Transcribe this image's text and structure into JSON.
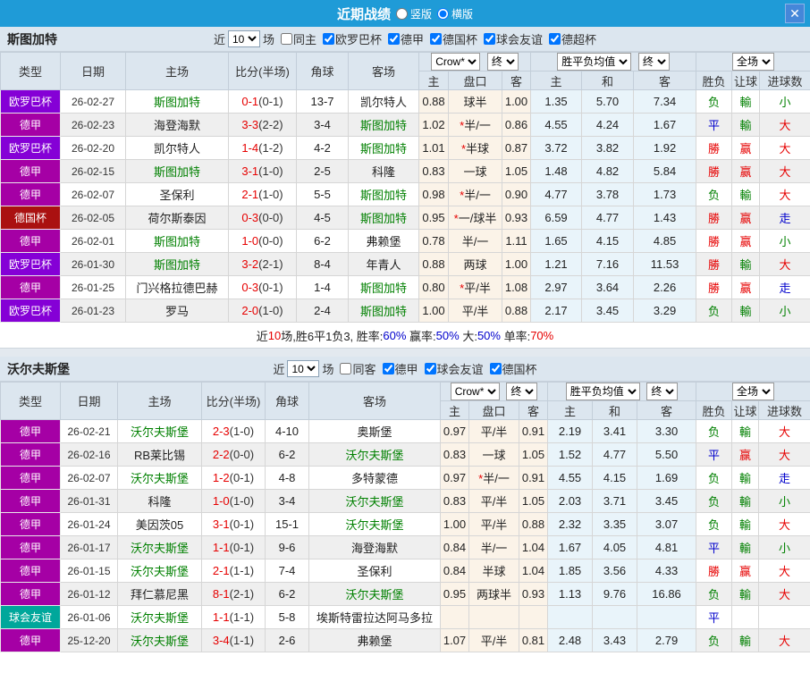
{
  "titlebar": {
    "title": "近期战绩",
    "vertical_label": "竖版",
    "horizontal_label": "横版",
    "selected": "横版",
    "close_icon": "✕",
    "bg_color": "#1f9bd7"
  },
  "labels": {
    "near": "近",
    "games": "场",
    "columns": [
      "类型",
      "日期",
      "主场",
      "比分(半场)",
      "角球",
      "客场"
    ],
    "subcolumns": [
      "主",
      "盘口",
      "客",
      "主",
      "和",
      "客",
      "胜负",
      "让球",
      "进球数"
    ]
  },
  "league_colors": {
    "europa": "#8500d6",
    "bundesliga": "#a500a5",
    "pokal": "#aa1111",
    "friendly": "#00a79b"
  },
  "status_colors": {
    "red": "#e60000",
    "blue": "#0000cc",
    "green": "#008000"
  },
  "tables": [
    {
      "team": "斯图加特",
      "near_count": "10",
      "same_label": "同主",
      "same_checked": false,
      "league_filters": [
        "欧罗巴杯",
        "德甲",
        "德国杯",
        "球会友谊",
        "德超杯"
      ],
      "dropdowns": {
        "company": "Crow*",
        "final1": "终",
        "avg": "胜平负均值",
        "final2": "终",
        "scope": "全场"
      },
      "rows": [
        {
          "league": "欧罗巴杯",
          "lg": "europa",
          "date": "26-02-27",
          "home": "斯图加特",
          "hf": 1,
          "score": "0-1",
          "half": "(0-1)",
          "corners": "13-7",
          "away": "凯尔特人",
          "af": 0,
          "h": "0.88",
          "star": "",
          "hcp": "球半",
          "a": "1.00",
          "ah": "1.35",
          "ad": "5.70",
          "aa": "7.34",
          "res": "负",
          "rc": "g",
          "hres": "輸",
          "gc": "g",
          "ou": "小",
          "oc": "g"
        },
        {
          "league": "德甲",
          "lg": "bundesliga",
          "date": "26-02-23",
          "home": "海登海默",
          "hf": 0,
          "score": "3-3",
          "half": "(2-2)",
          "corners": "3-4",
          "away": "斯图加特",
          "af": 1,
          "h": "1.02",
          "star": "*",
          "hcp": "半/一",
          "a": "0.86",
          "ah": "4.55",
          "ad": "4.24",
          "aa": "1.67",
          "res": "平",
          "rc": "b",
          "hres": "輸",
          "gc": "g",
          "ou": "大",
          "oc": "r"
        },
        {
          "league": "欧罗巴杯",
          "lg": "europa",
          "date": "26-02-20",
          "home": "凯尔特人",
          "hf": 0,
          "score": "1-4",
          "half": "(1-2)",
          "corners": "4-2",
          "away": "斯图加特",
          "af": 1,
          "h": "1.01",
          "star": "*",
          "hcp": "半球",
          "a": "0.87",
          "ah": "3.72",
          "ad": "3.82",
          "aa": "1.92",
          "res": "勝",
          "rc": "r",
          "hres": "赢",
          "gc": "r",
          "ou": "大",
          "oc": "r"
        },
        {
          "league": "德甲",
          "lg": "bundesliga",
          "date": "26-02-15",
          "home": "斯图加特",
          "hf": 1,
          "score": "3-1",
          "half": "(1-0)",
          "corners": "2-5",
          "away": "科隆",
          "af": 0,
          "h": "0.83",
          "star": "",
          "hcp": "一球",
          "a": "1.05",
          "ah": "1.48",
          "ad": "4.82",
          "aa": "5.84",
          "res": "勝",
          "rc": "r",
          "hres": "赢",
          "gc": "r",
          "ou": "大",
          "oc": "r"
        },
        {
          "league": "德甲",
          "lg": "bundesliga",
          "date": "26-02-07",
          "home": "圣保利",
          "hf": 0,
          "score": "2-1",
          "half": "(1-0)",
          "corners": "5-5",
          "away": "斯图加特",
          "af": 1,
          "h": "0.98",
          "star": "*",
          "hcp": "半/一",
          "a": "0.90",
          "ah": "4.77",
          "ad": "3.78",
          "aa": "1.73",
          "res": "负",
          "rc": "g",
          "hres": "輸",
          "gc": "g",
          "ou": "大",
          "oc": "r"
        },
        {
          "league": "德国杯",
          "lg": "pokal",
          "date": "26-02-05",
          "home": "荷尔斯泰因",
          "hf": 0,
          "score": "0-3",
          "half": "(0-0)",
          "corners": "4-5",
          "away": "斯图加特",
          "af": 1,
          "h": "0.95",
          "star": "*",
          "hcp": "一/球半",
          "a": "0.93",
          "ah": "6.59",
          "ad": "4.77",
          "aa": "1.43",
          "res": "勝",
          "rc": "r",
          "hres": "赢",
          "gc": "r",
          "ou": "走",
          "oc": "b"
        },
        {
          "league": "德甲",
          "lg": "bundesliga",
          "date": "26-02-01",
          "home": "斯图加特",
          "hf": 1,
          "score": "1-0",
          "half": "(0-0)",
          "corners": "6-2",
          "away": "弗赖堡",
          "af": 0,
          "h": "0.78",
          "star": "",
          "hcp": "半/一",
          "a": "1.11",
          "ah": "1.65",
          "ad": "4.15",
          "aa": "4.85",
          "res": "勝",
          "rc": "r",
          "hres": "赢",
          "gc": "r",
          "ou": "小",
          "oc": "g"
        },
        {
          "league": "欧罗巴杯",
          "lg": "europa",
          "date": "26-01-30",
          "home": "斯图加特",
          "hf": 1,
          "score": "3-2",
          "half": "(2-1)",
          "corners": "8-4",
          "away": "年青人",
          "af": 0,
          "h": "0.88",
          "star": "",
          "hcp": "两球",
          "a": "1.00",
          "ah": "1.21",
          "ad": "7.16",
          "aa": "11.53",
          "res": "勝",
          "rc": "r",
          "hres": "輸",
          "gc": "g",
          "ou": "大",
          "oc": "r"
        },
        {
          "league": "德甲",
          "lg": "bundesliga",
          "date": "26-01-25",
          "home": "门兴格拉德巴赫",
          "hf": 0,
          "score": "0-3",
          "half": "(0-1)",
          "corners": "1-4",
          "away": "斯图加特",
          "af": 1,
          "h": "0.80",
          "star": "*",
          "hcp": "平/半",
          "a": "1.08",
          "ah": "2.97",
          "ad": "3.64",
          "aa": "2.26",
          "res": "勝",
          "rc": "r",
          "hres": "赢",
          "gc": "r",
          "ou": "走",
          "oc": "b"
        },
        {
          "league": "欧罗巴杯",
          "lg": "europa",
          "date": "26-01-23",
          "home": "罗马",
          "hf": 0,
          "score": "2-0",
          "half": "(1-0)",
          "corners": "2-4",
          "away": "斯图加特",
          "af": 1,
          "h": "1.00",
          "star": "",
          "hcp": "平/半",
          "a": "0.88",
          "ah": "2.17",
          "ad": "3.45",
          "aa": "3.29",
          "res": "负",
          "rc": "g",
          "hres": "輸",
          "gc": "g",
          "ou": "小",
          "oc": "g"
        }
      ],
      "summary": [
        {
          "t": "近",
          "c": "k"
        },
        {
          "t": "10",
          "c": "r"
        },
        {
          "t": "场,胜6平1负3, ",
          "c": "k"
        },
        {
          "t": "胜率:",
          "c": "k"
        },
        {
          "t": "60%",
          "c": "b"
        },
        {
          "t": " 赢率:",
          "c": "k"
        },
        {
          "t": "50%",
          "c": "b"
        },
        {
          "t": " 大:",
          "c": "k"
        },
        {
          "t": "50%",
          "c": "b"
        },
        {
          "t": " 单率:",
          "c": "k"
        },
        {
          "t": "70%",
          "c": "r"
        }
      ]
    },
    {
      "team": "沃尔夫斯堡",
      "near_count": "10",
      "same_label": "同客",
      "same_checked": false,
      "league_filters": [
        "德甲",
        "球会友谊",
        "德国杯"
      ],
      "dropdowns": {
        "company": "Crow*",
        "final1": "终",
        "avg": "胜平负均值",
        "final2": "终",
        "scope": "全场"
      },
      "rows": [
        {
          "league": "德甲",
          "lg": "bundesliga",
          "date": "26-02-21",
          "home": "沃尔夫斯堡",
          "hf": 1,
          "score": "2-3",
          "half": "(1-0)",
          "corners": "4-10",
          "away": "奥斯堡",
          "af": 0,
          "h": "0.97",
          "star": "",
          "hcp": "平/半",
          "a": "0.91",
          "ah": "2.19",
          "ad": "3.41",
          "aa": "3.30",
          "res": "负",
          "rc": "g",
          "hres": "輸",
          "gc": "g",
          "ou": "大",
          "oc": "r"
        },
        {
          "league": "德甲",
          "lg": "bundesliga",
          "date": "26-02-16",
          "home": "RB莱比锡",
          "hf": 0,
          "score": "2-2",
          "half": "(0-0)",
          "corners": "6-2",
          "away": "沃尔夫斯堡",
          "af": 1,
          "h": "0.83",
          "star": "",
          "hcp": "一球",
          "a": "1.05",
          "ah": "1.52",
          "ad": "4.77",
          "aa": "5.50",
          "res": "平",
          "rc": "b",
          "hres": "赢",
          "gc": "r",
          "ou": "大",
          "oc": "r"
        },
        {
          "league": "德甲",
          "lg": "bundesliga",
          "date": "26-02-07",
          "home": "沃尔夫斯堡",
          "hf": 1,
          "score": "1-2",
          "half": "(0-1)",
          "corners": "4-8",
          "away": "多特蒙德",
          "af": 0,
          "h": "0.97",
          "star": "*",
          "hcp": "半/一",
          "a": "0.91",
          "ah": "4.55",
          "ad": "4.15",
          "aa": "1.69",
          "res": "负",
          "rc": "g",
          "hres": "輸",
          "gc": "g",
          "ou": "走",
          "oc": "b"
        },
        {
          "league": "德甲",
          "lg": "bundesliga",
          "date": "26-01-31",
          "home": "科隆",
          "hf": 0,
          "score": "1-0",
          "half": "(1-0)",
          "corners": "3-4",
          "away": "沃尔夫斯堡",
          "af": 1,
          "h": "0.83",
          "star": "",
          "hcp": "平/半",
          "a": "1.05",
          "ah": "2.03",
          "ad": "3.71",
          "aa": "3.45",
          "res": "负",
          "rc": "g",
          "hres": "輸",
          "gc": "g",
          "ou": "小",
          "oc": "g"
        },
        {
          "league": "德甲",
          "lg": "bundesliga",
          "date": "26-01-24",
          "home": "美因茨05",
          "hf": 0,
          "score": "3-1",
          "half": "(0-1)",
          "corners": "15-1",
          "away": "沃尔夫斯堡",
          "af": 1,
          "h": "1.00",
          "star": "",
          "hcp": "平/半",
          "a": "0.88",
          "ah": "2.32",
          "ad": "3.35",
          "aa": "3.07",
          "res": "负",
          "rc": "g",
          "hres": "輸",
          "gc": "g",
          "ou": "大",
          "oc": "r"
        },
        {
          "league": "德甲",
          "lg": "bundesliga",
          "date": "26-01-17",
          "home": "沃尔夫斯堡",
          "hf": 1,
          "score": "1-1",
          "half": "(0-1)",
          "corners": "9-6",
          "away": "海登海默",
          "af": 0,
          "h": "0.84",
          "star": "",
          "hcp": "半/一",
          "a": "1.04",
          "ah": "1.67",
          "ad": "4.05",
          "aa": "4.81",
          "res": "平",
          "rc": "b",
          "hres": "輸",
          "gc": "g",
          "ou": "小",
          "oc": "g"
        },
        {
          "league": "德甲",
          "lg": "bundesliga",
          "date": "26-01-15",
          "home": "沃尔夫斯堡",
          "hf": 1,
          "score": "2-1",
          "half": "(1-1)",
          "corners": "7-4",
          "away": "圣保利",
          "af": 0,
          "h": "0.84",
          "star": "",
          "hcp": "半球",
          "a": "1.04",
          "ah": "1.85",
          "ad": "3.56",
          "aa": "4.33",
          "res": "勝",
          "rc": "r",
          "hres": "赢",
          "gc": "r",
          "ou": "大",
          "oc": "r"
        },
        {
          "league": "德甲",
          "lg": "bundesliga",
          "date": "26-01-12",
          "home": "拜仁慕尼黑",
          "hf": 0,
          "score": "8-1",
          "half": "(2-1)",
          "corners": "6-2",
          "away": "沃尔夫斯堡",
          "af": 1,
          "h": "0.95",
          "star": "",
          "hcp": "两球半",
          "a": "0.93",
          "ah": "1.13",
          "ad": "9.76",
          "aa": "16.86",
          "res": "负",
          "rc": "g",
          "hres": "輸",
          "gc": "g",
          "ou": "大",
          "oc": "r"
        },
        {
          "league": "球会友谊",
          "lg": "friendly",
          "date": "26-01-06",
          "home": "沃尔夫斯堡",
          "hf": 1,
          "score": "1-1",
          "half": "(1-1)",
          "corners": "5-8",
          "away": "埃斯特雷拉达阿马多拉",
          "af": 0,
          "h": "",
          "star": "",
          "hcp": "",
          "a": "",
          "ah": "",
          "ad": "",
          "aa": "",
          "res": "平",
          "rc": "b",
          "hres": "",
          "gc": "k",
          "ou": "",
          "oc": "k"
        },
        {
          "league": "德甲",
          "lg": "bundesliga",
          "date": "25-12-20",
          "home": "沃尔夫斯堡",
          "hf": 1,
          "score": "3-4",
          "half": "(1-1)",
          "corners": "2-6",
          "away": "弗赖堡",
          "af": 0,
          "h": "1.07",
          "star": "",
          "hcp": "平/半",
          "a": "0.81",
          "ah": "2.48",
          "ad": "3.43",
          "aa": "2.79",
          "res": "负",
          "rc": "g",
          "hres": "輸",
          "gc": "g",
          "ou": "大",
          "oc": "r"
        }
      ],
      "summary": null
    }
  ]
}
